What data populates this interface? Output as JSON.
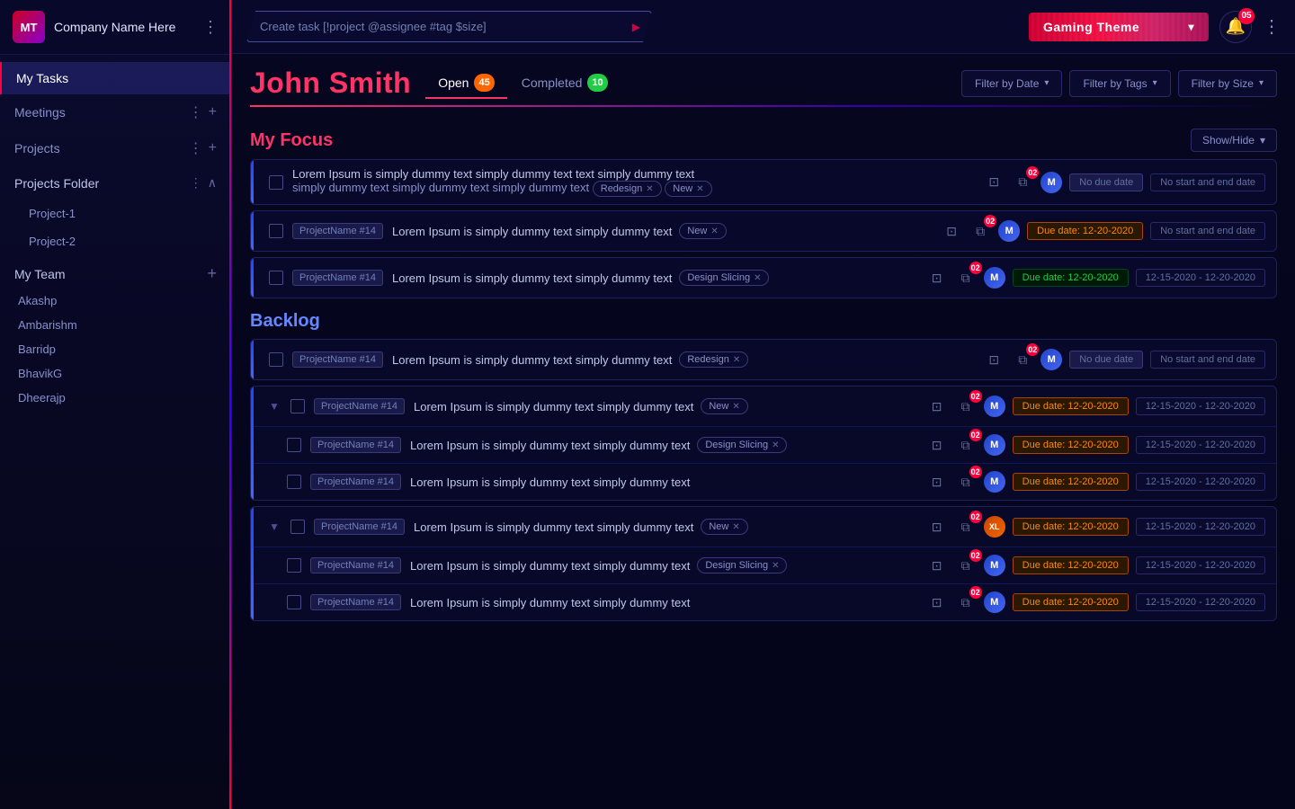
{
  "sidebar": {
    "logo_text": "MT",
    "company_name": "Company Name Here",
    "nav_items": [
      {
        "id": "my-tasks",
        "label": "My Tasks",
        "active": true
      },
      {
        "id": "meetings",
        "label": "Meetings"
      },
      {
        "id": "projects",
        "label": "Projects"
      }
    ],
    "projects_folder": {
      "label": "Projects Folder",
      "sub_items": [
        "Project-1",
        "Project-2"
      ]
    },
    "my_team": {
      "label": "My Team",
      "members": [
        "Akashp",
        "Ambarishm",
        "Barridp",
        "BhavikG",
        "Dheerajp"
      ]
    }
  },
  "topbar": {
    "create_task_placeholder": "Create task [!project @assignee #tag $size]",
    "theme_button_label": "Gaming Theme",
    "notif_count": "05",
    "menu_icon": "⋮"
  },
  "page": {
    "title": "John Smith",
    "tabs": [
      {
        "id": "open",
        "label": "Open",
        "count": "45",
        "badge_class": "orange",
        "active": true
      },
      {
        "id": "completed",
        "label": "Completed",
        "count": "10",
        "badge_class": "green"
      }
    ],
    "filters": [
      {
        "label": "Filter by Date"
      },
      {
        "label": "Filter by Tags"
      },
      {
        "label": "Filter by Size"
      }
    ]
  },
  "my_focus": {
    "title": "My Focus",
    "show_hide_label": "Show/Hide",
    "tasks": [
      {
        "id": 1,
        "project_tag": null,
        "text_line1": "Lorem Ipsum is simply dummy text simply dummy text text simply dummy text",
        "text_line2": "simply dummy text simply dummy text simply dummy text",
        "tags": [
          "Redesign",
          "New"
        ],
        "count": "02",
        "avatar": "M",
        "due_label": "No due date",
        "due_class": "no-date",
        "range_label": "No start and end date"
      },
      {
        "id": 2,
        "project_tag": "ProjectName #14",
        "text": "Lorem Ipsum is simply dummy text simply dummy text",
        "tags": [
          "New"
        ],
        "count": "02",
        "avatar": "M",
        "due_label": "Due date: 12-20-2020",
        "due_class": "due-orange",
        "range_label": "No start and end date"
      },
      {
        "id": 3,
        "project_tag": "ProjectName #14",
        "text": "Lorem Ipsum is simply dummy text simply dummy text",
        "tags": [
          "Design Slicing"
        ],
        "count": "02",
        "avatar": "M",
        "due_label": "Due date: 12-20-2020",
        "due_class": "due-green",
        "range_label": "12-15-2020 - 12-20-2020"
      }
    ]
  },
  "backlog": {
    "title": "Backlog",
    "task_groups": [
      {
        "id": "bg1",
        "project_tag": "ProjectName #14",
        "text": "Lorem Ipsum is simply dummy text simply dummy text",
        "tags": [
          "Redesign"
        ],
        "count": "02",
        "avatar": "M",
        "due_label": "No due date",
        "due_class": "no-date",
        "range_label": "No start and end date"
      },
      {
        "id": "bg2",
        "project_tag": "ProjectName #14",
        "text": "Lorem Ipsum is simply dummy text simply dummy text",
        "tags": [
          "New"
        ],
        "count": "02",
        "avatar": "M",
        "due_label": "Due date: 12-20-2020",
        "due_class": "due-orange",
        "range_label": "12-15-2020 - 12-20-2020",
        "sub_tasks": [
          {
            "project_tag": "ProjectName #14",
            "text": "Lorem Ipsum is simply dummy text simply dummy text",
            "tags": [
              "Design Slicing"
            ],
            "count": "02",
            "avatar": "M",
            "due_label": "Due date: 12-20-2020",
            "range_label": "12-15-2020 - 12-20-2020"
          },
          {
            "project_tag": "ProjectName #14",
            "text": "Lorem Ipsum is simply dummy text simply dummy text",
            "tags": [],
            "count": "02",
            "avatar": "M",
            "due_label": "Due date: 12-20-2020",
            "range_label": "12-15-2020 - 12-20-2020"
          }
        ]
      },
      {
        "id": "bg3",
        "project_tag": "ProjectName #14",
        "text": "Lorem Ipsum is simply dummy text simply dummy text",
        "tags": [
          "New"
        ],
        "count": "02",
        "avatar": "XL",
        "due_label": "Due date: 12-20-2020",
        "due_class": "due-orange",
        "range_label": "12-15-2020 - 12-20-2020",
        "sub_tasks": [
          {
            "project_tag": "ProjectName #14",
            "text": "Lorem Ipsum is simply dummy text simply dummy text",
            "tags": [
              "Design Slicing"
            ],
            "count": "02",
            "avatar": "M",
            "due_label": "Due date: 12-20-2020",
            "range_label": "12-15-2020 - 12-20-2020"
          },
          {
            "project_tag": "ProjectName #14",
            "text": "Lorem Ipsum is simply dummy text simply dummy text",
            "tags": [],
            "count": "02",
            "avatar": "M",
            "due_label": "Due date: 12-20-2020",
            "range_label": "12-15-2020 - 12-20-2020"
          }
        ]
      }
    ]
  },
  "icons": {
    "expand_square": "⊡",
    "screenshot": "⧉",
    "menu_dots": "⋮",
    "plus": "+",
    "bell": "🔔",
    "chevron_down": "▾",
    "check": "✓"
  }
}
